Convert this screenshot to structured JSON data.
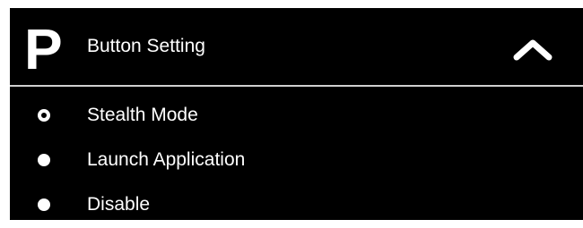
{
  "header": {
    "badge_letter": "P",
    "title": "Button Setting",
    "collapse_icon": "chevron-up-icon"
  },
  "options": [
    {
      "label": "Stealth Mode",
      "selected": true
    },
    {
      "label": "Launch Application",
      "selected": false
    },
    {
      "label": "Disable",
      "selected": false
    }
  ],
  "colors": {
    "panel_bg": "#000000",
    "text": "#ffffff",
    "divider": "#cfcfcf"
  }
}
